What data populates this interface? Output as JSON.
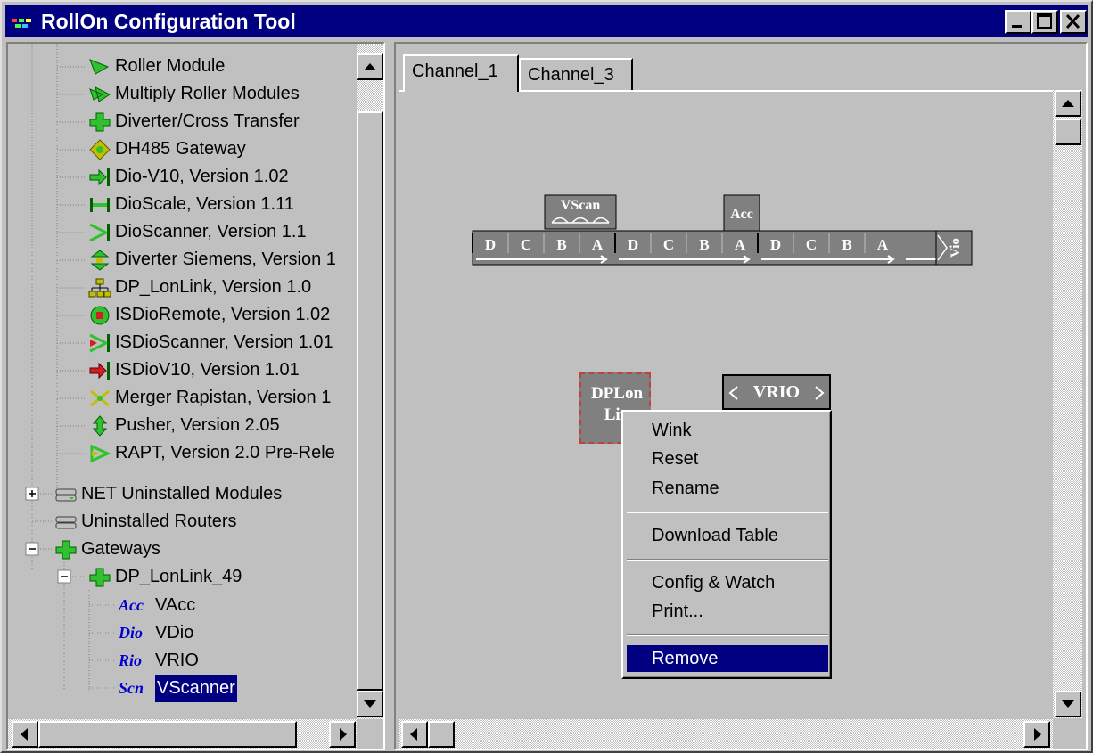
{
  "window": {
    "title": "RollOn Configuration Tool"
  },
  "tree": {
    "items": [
      {
        "label": "Roller Module",
        "icon": "roller-module-icon"
      },
      {
        "label": "Multiply Roller Modules",
        "icon": "multiply-roller-icon"
      },
      {
        "label": "Diverter/Cross Transfer",
        "icon": "diverter-icon"
      },
      {
        "label": "DH485 Gateway",
        "icon": "dh485-gateway-icon"
      },
      {
        "label": "Dio-V10, Version 1.02",
        "icon": "dio-v10-icon"
      },
      {
        "label": "DioScale, Version 1.11",
        "icon": "dioscale-icon"
      },
      {
        "label": "DioScanner, Version 1.1",
        "icon": "dioscanner-icon"
      },
      {
        "label": "Diverter Siemens, Version 1",
        "icon": "diverter-siemens-icon"
      },
      {
        "label": "DP_LonLink, Version 1.0",
        "icon": "dp-lonlink-icon"
      },
      {
        "label": "ISDioRemote, Version 1.02",
        "icon": "isdioremote-icon"
      },
      {
        "label": "ISDioScanner, Version 1.01",
        "icon": "isdioscanner-icon"
      },
      {
        "label": "ISDioV10, Version 1.01",
        "icon": "isdiov10-icon"
      },
      {
        "label": "Merger Rapistan, Version 1",
        "icon": "merger-icon"
      },
      {
        "label": "Pusher, Version 2.05",
        "icon": "pusher-icon"
      },
      {
        "label": "RAPT, Version 2.0 Pre-Rele",
        "icon": "rapt-icon"
      }
    ],
    "net_uninstalled": "NET Uninstalled Modules",
    "uninstalled_routers": "Uninstalled Routers",
    "gateways": "Gateways",
    "gateway_child": "DP_LonLink_49",
    "leaves": [
      {
        "tag": "Acc",
        "label": "VAcc"
      },
      {
        "tag": "Dio",
        "label": "VDio"
      },
      {
        "tag": "Rio",
        "label": "VRIO"
      },
      {
        "tag": "Scn",
        "label": "VScanner"
      }
    ]
  },
  "tabs": [
    "Channel_1",
    "Channel_3"
  ],
  "canvas": {
    "vscan_label": "VScan",
    "acc_label": "Acc",
    "rail_letters": [
      "D",
      "C",
      "B",
      "A",
      "D",
      "C",
      "B",
      "A",
      "D",
      "C",
      "B",
      "A"
    ],
    "vio_label": "Vio",
    "dplon_line1": "DPLon",
    "dplon_line2": "Lin",
    "vrio_label": "VRIO"
  },
  "context_menu": {
    "items": [
      "Wink",
      "Reset",
      "Rename",
      "Download Table",
      "Config & Watch",
      "Print...",
      "Remove"
    ],
    "selected": "Remove"
  },
  "colors": {
    "title_bar": "#000080",
    "selection": "#000080",
    "tag_blue": "#0000d0",
    "block_gray": "#808080"
  }
}
